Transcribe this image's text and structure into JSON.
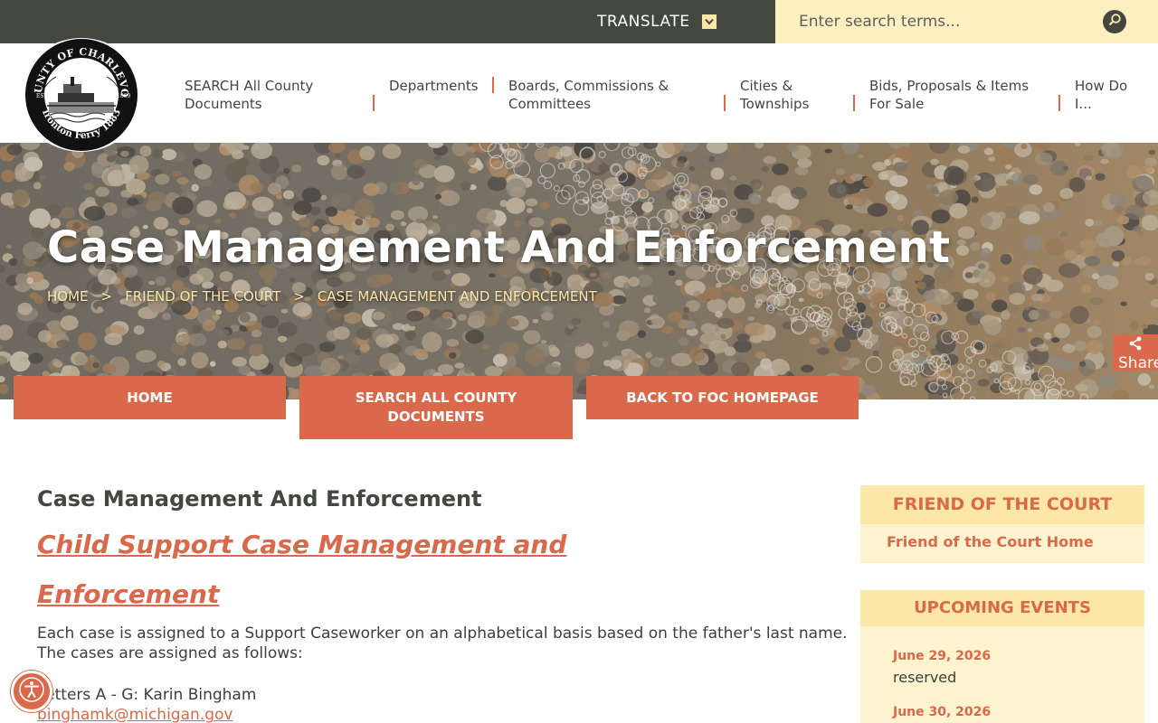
{
  "colors": {
    "topbar": "#434740",
    "accent": "#d9694a",
    "cream": "#fbe7a8",
    "cream_light": "#fdf3cf",
    "text": "#3c3f3a"
  },
  "topbar": {
    "translate_label": "TRANSLATE",
    "translate_icon": "chevron-down-icon",
    "search_placeholder": "Enter search terms...",
    "search_icon": "magnifier-icon"
  },
  "logo": {
    "top_text": "COUNTY OF CHARLEVOIX",
    "bottom_text": "Ironton Ferry 1883",
    "est": "EST.",
    "year": "1869"
  },
  "nav": {
    "items": [
      {
        "line1": "SEARCH All County",
        "line2": "Documents"
      },
      {
        "line1": "Departments",
        "line2": ""
      },
      {
        "line1": "Boards, Commissions &",
        "line2": "Committees"
      },
      {
        "line1": "Cities &",
        "line2": "Townships"
      },
      {
        "line1": "Bids, Proposals & Items",
        "line2": "For Sale"
      },
      {
        "line1": "How Do",
        "line2": "I..."
      }
    ]
  },
  "hero": {
    "title": "Case Management And Enforcement",
    "breadcrumbs": [
      "HOME",
      ">",
      "FRIEND OF THE COURT",
      ">",
      "CASE MANAGEMENT AND ENFORCEMENT"
    ]
  },
  "share": {
    "label": "Share",
    "icon": "share-icon"
  },
  "buttons": {
    "home": "HOME",
    "search_line1": "SEARCH ALL COUNTY",
    "search_line2": "DOCUMENTS",
    "back": "BACK TO FOC HOMEPAGE"
  },
  "main": {
    "heading": "Case Management And Enforcement",
    "link_line1": "Child Support Case Management and",
    "link_line2": "Enforcement",
    "paragraph": "Each case is assigned to a Support Caseworker on an alphabetical basis based on the father's last name. The cases are assigned as follows:",
    "assignment": "Letters A - G:  Karin Bingham",
    "email": "binghamk@michigan.gov"
  },
  "sidebar": {
    "foc": {
      "title": "FRIEND OF THE COURT",
      "link": "Friend of the Court Home"
    },
    "events": {
      "title": "UPCOMING EVENTS",
      "items": [
        {
          "date": "June 29, 2026",
          "title": "reserved"
        },
        {
          "date": "June 30, 2026",
          "title": ""
        }
      ]
    }
  },
  "accessibility_icon": "accessibility-icon"
}
